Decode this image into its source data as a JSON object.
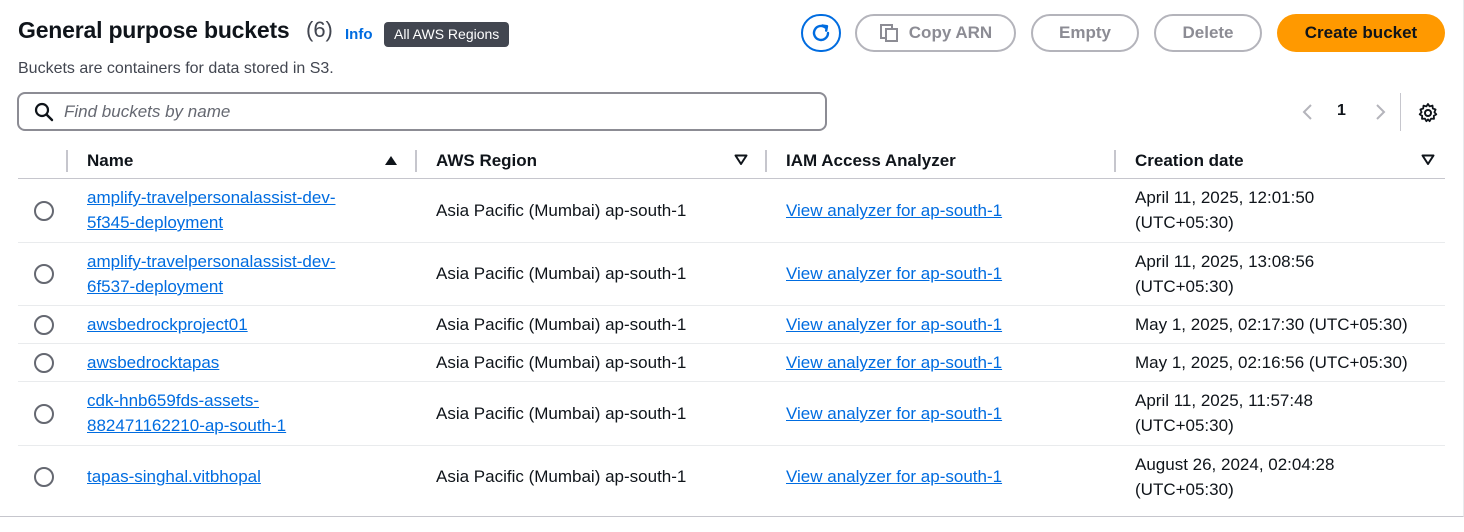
{
  "header": {
    "title": "General purpose buckets",
    "count": "(6)",
    "info": "Info",
    "region_badge": "All AWS Regions",
    "subtitle": "Buckets are containers for data stored in S3."
  },
  "actions": {
    "copy_arn": "Copy ARN",
    "empty": "Empty",
    "delete": "Delete",
    "create": "Create bucket"
  },
  "search": {
    "placeholder": "Find buckets by name",
    "value": ""
  },
  "pagination": {
    "current_page": "1"
  },
  "table": {
    "columns": [
      "Name",
      "AWS Region",
      "IAM Access Analyzer",
      "Creation date"
    ],
    "rows": [
      {
        "name": "amplify-travelpersonalassist-dev-5f345-deployment",
        "name_lines": [
          "amplify-travelpersonalassist-dev-",
          "5f345-deployment"
        ],
        "region": "Asia Pacific (Mumbai) ap-south-1",
        "iam": "View analyzer for ap-south-1",
        "date_lines": [
          "April 11, 2025, 12:01:50",
          "(UTC+05:30)"
        ]
      },
      {
        "name": "amplify-travelpersonalassist-dev-6f537-deployment",
        "name_lines": [
          "amplify-travelpersonalassist-dev-",
          "6f537-deployment"
        ],
        "region": "Asia Pacific (Mumbai) ap-south-1",
        "iam": "View analyzer for ap-south-1",
        "date_lines": [
          "April 11, 2025, 13:08:56",
          "(UTC+05:30)"
        ]
      },
      {
        "name": "awsbedrockproject01",
        "name_lines": [
          "awsbedrockproject01"
        ],
        "region": "Asia Pacific (Mumbai) ap-south-1",
        "iam": "View analyzer for ap-south-1",
        "date_lines": [
          "May 1, 2025, 02:17:30 (UTC+05:30)"
        ]
      },
      {
        "name": "awsbedrocktapas",
        "name_lines": [
          "awsbedrocktapas"
        ],
        "region": "Asia Pacific (Mumbai) ap-south-1",
        "iam": "View analyzer for ap-south-1",
        "date_lines": [
          "May 1, 2025, 02:16:56 (UTC+05:30)"
        ]
      },
      {
        "name": "cdk-hnb659fds-assets-882471162210-ap-south-1",
        "name_lines": [
          "cdk-hnb659fds-assets-",
          "882471162210-ap-south-1"
        ],
        "region": "Asia Pacific (Mumbai) ap-south-1",
        "iam": "View analyzer for ap-south-1",
        "date_lines": [
          "April 11, 2025, 11:57:48",
          "(UTC+05:30)"
        ]
      },
      {
        "name": "tapas-singhal.vitbhopal",
        "name_lines": [
          "tapas-singhal.vitbhopal"
        ],
        "region": "Asia Pacific (Mumbai) ap-south-1",
        "iam": "View analyzer for ap-south-1",
        "date_lines": [
          "August 26, 2024, 02:04:28",
          "(UTC+05:30)"
        ]
      }
    ]
  },
  "colors": {
    "link": "#006ce0",
    "primary": "#ff9900",
    "badge": "#424650",
    "disabled": "#8c8c94"
  }
}
